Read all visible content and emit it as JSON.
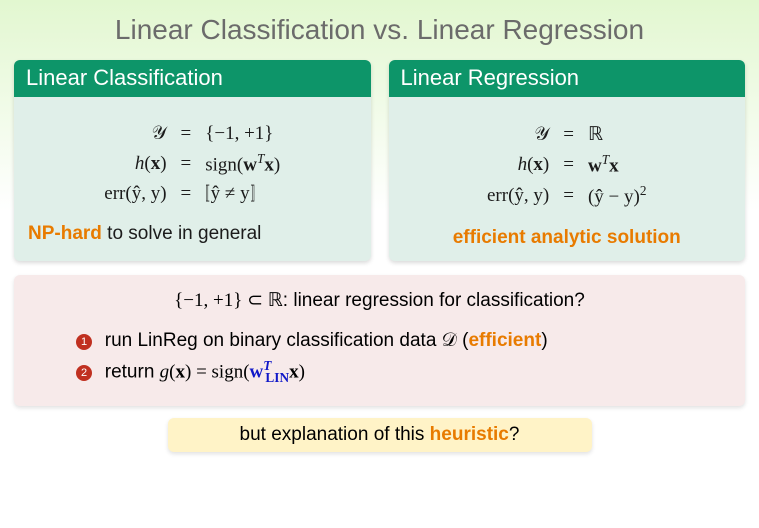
{
  "title": "Linear Classification vs. Linear Regression",
  "left": {
    "header": "Linear Classification",
    "eq1_lhs": "𝒴",
    "eq1_rhs": "{−1, +1}",
    "eq2_lhs_h": "h",
    "eq2_lhs_x": "x",
    "eq2_rhs_pre": "sign(",
    "eq2_rhs_w": "w",
    "eq2_rhs_T": "T",
    "eq2_rhs_x": "x",
    "eq2_rhs_post": ")",
    "eq3_lhs": "err(ŷ, y)",
    "eq3_rhs_core": "ŷ ≠ y",
    "note_em": "NP-hard",
    "note_rest": " to solve in general"
  },
  "right": {
    "header": "Linear Regression",
    "eq1_lhs": "𝒴",
    "eq1_rhs": "ℝ",
    "eq2_lhs_h": "h",
    "eq2_lhs_x": "x",
    "eq2_rhs_w": "w",
    "eq2_rhs_T": "T",
    "eq2_rhs_x": "x",
    "eq3_lhs": "err(ŷ, y)",
    "eq3_rhs": "(ŷ − y)",
    "eq3_rhs_exp": "2",
    "note": "efficient analytic solution"
  },
  "pink": {
    "lead_set": "{−1, +1} ⊂ ℝ",
    "lead_rest": ": linear regression for classification?",
    "step1_num": "1",
    "step1_a": "run LinReg on binary classification data ",
    "step1_D": "𝒟",
    "step1_paren_open": " (",
    "step1_eff": "efficient",
    "step1_paren_close": ")",
    "step2_num": "2",
    "step2_a": "return ",
    "step2_g": "g",
    "step2_x1": "x",
    "step2_mid": ") = sign(",
    "step2_w": "w",
    "step2_T": "T",
    "step2_sub": "LIN",
    "step2_x2": "x",
    "step2_end": ")"
  },
  "yellow": {
    "a": "but explanation of this ",
    "b": "heuristic",
    "c": "?"
  },
  "eq_sign": "="
}
